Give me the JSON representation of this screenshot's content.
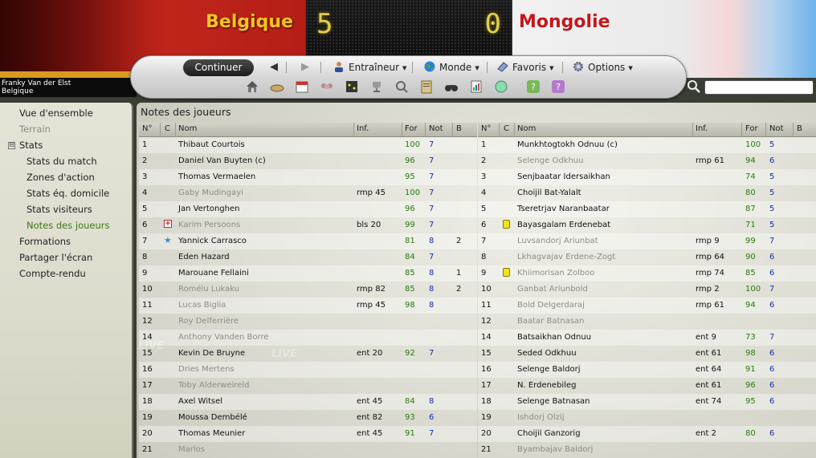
{
  "header": {
    "home_team": "Belgique",
    "away_team": "Mongolie",
    "home_score": "5",
    "away_score": "0",
    "manager_name": "Franky Van der Elst",
    "manager_team": "Belgique"
  },
  "toolbar": {
    "continue_label": "Continuer",
    "back_icon": "back-arrow-icon",
    "forward_icon": "forward-arrow-icon",
    "menus": [
      {
        "label": "Entraîneur",
        "icon": "person-icon"
      },
      {
        "label": "Monde",
        "icon": "globe-icon"
      },
      {
        "label": "Favoris",
        "icon": "bookmark-icon"
      },
      {
        "label": "Options",
        "icon": "gear-icon"
      }
    ],
    "icons": [
      "home-icon",
      "inbox-icon",
      "calendar-icon",
      "squad-icon",
      "tactics-icon",
      "trophy-icon",
      "scout-icon",
      "clipboard-icon",
      "binoculars-icon",
      "report-icon",
      "world-icon",
      "help-icon",
      "question-icon"
    ]
  },
  "search": {
    "placeholder": "",
    "value": ""
  },
  "sidebar": {
    "items": [
      {
        "label": "Vue d'ensemble",
        "state": "normal"
      },
      {
        "label": "Terrain",
        "state": "disabled"
      },
      {
        "label": "Stats",
        "state": "normal"
      },
      {
        "label": "Stats du match",
        "state": "normal"
      },
      {
        "label": "Zones d'action",
        "state": "normal"
      },
      {
        "label": "Stats éq. domicile",
        "state": "normal"
      },
      {
        "label": "Stats visiteurs",
        "state": "normal"
      },
      {
        "label": "Notes des joueurs",
        "state": "active"
      },
      {
        "label": "Formations",
        "state": "normal"
      },
      {
        "label": "Partager l'écran",
        "state": "normal"
      },
      {
        "label": "Compte-rendu",
        "state": "normal"
      }
    ],
    "stats_toggle": "⊟"
  },
  "main": {
    "title": "Notes des joueurs",
    "columns": [
      "N°",
      "C",
      "Nom",
      "Inf.",
      "For",
      "Not",
      "B"
    ],
    "watermark": "LIVE"
  },
  "home_players": [
    {
      "num": "1",
      "mark": "",
      "name": "Thibaut Courtois",
      "inf": "",
      "for": "100",
      "not": "7",
      "b": "",
      "unused": false
    },
    {
      "num": "2",
      "mark": "",
      "name": "Daniel Van Buyten (c)",
      "inf": "",
      "for": "96",
      "not": "7",
      "b": "",
      "unused": false
    },
    {
      "num": "3",
      "mark": "",
      "name": "Thomas Vermaelen",
      "inf": "",
      "for": "95",
      "not": "7",
      "b": "",
      "unused": false
    },
    {
      "num": "4",
      "mark": "",
      "name": "Gaby Mudingayi",
      "inf": "rmp 45",
      "for": "100",
      "not": "7",
      "b": "",
      "unused": true
    },
    {
      "num": "5",
      "mark": "",
      "name": "Jan Vertonghen",
      "inf": "",
      "for": "96",
      "not": "7",
      "b": "",
      "unused": false
    },
    {
      "num": "6",
      "mark": "injury",
      "name": "Karim Persoons",
      "inf": "bls 20",
      "for": "99",
      "not": "7",
      "b": "",
      "unused": true
    },
    {
      "num": "7",
      "mark": "star",
      "name": "Yannick Carrasco",
      "inf": "",
      "for": "81",
      "not": "8",
      "b": "2",
      "unused": false
    },
    {
      "num": "8",
      "mark": "",
      "name": "Eden Hazard",
      "inf": "",
      "for": "84",
      "not": "7",
      "b": "",
      "unused": false
    },
    {
      "num": "9",
      "mark": "",
      "name": "Marouane Fellaini",
      "inf": "",
      "for": "85",
      "not": "8",
      "b": "1",
      "unused": false
    },
    {
      "num": "10",
      "mark": "",
      "name": "Romélu Lukaku",
      "inf": "rmp 82",
      "for": "85",
      "not": "8",
      "b": "2",
      "unused": true
    },
    {
      "num": "11",
      "mark": "",
      "name": "Lucas Biglia",
      "inf": "rmp 45",
      "for": "98",
      "not": "8",
      "b": "",
      "unused": true
    },
    {
      "num": "12",
      "mark": "",
      "name": "Roy Delferrière",
      "inf": "",
      "for": "",
      "not": "",
      "b": "",
      "unused": true
    },
    {
      "num": "14",
      "mark": "",
      "name": "Anthony Vanden Borre",
      "inf": "",
      "for": "",
      "not": "",
      "b": "",
      "unused": true
    },
    {
      "num": "15",
      "mark": "",
      "name": "Kevin De Bruyne",
      "inf": "ent 20",
      "for": "92",
      "not": "7",
      "b": "",
      "unused": false
    },
    {
      "num": "16",
      "mark": "",
      "name": "Dries Mertens",
      "inf": "",
      "for": "",
      "not": "",
      "b": "",
      "unused": true
    },
    {
      "num": "17",
      "mark": "",
      "name": "Toby Alderweireld",
      "inf": "",
      "for": "",
      "not": "",
      "b": "",
      "unused": true
    },
    {
      "num": "18",
      "mark": "",
      "name": "Axel Witsel",
      "inf": "ent 45",
      "for": "84",
      "not": "8",
      "b": "",
      "unused": false
    },
    {
      "num": "19",
      "mark": "",
      "name": "Moussa Dembélé",
      "inf": "ent 82",
      "for": "93",
      "not": "6",
      "b": "",
      "unused": false
    },
    {
      "num": "20",
      "mark": "",
      "name": "Thomas Meunier",
      "inf": "ent 45",
      "for": "91",
      "not": "7",
      "b": "",
      "unused": false
    },
    {
      "num": "21",
      "mark": "",
      "name": "Marlos",
      "inf": "",
      "for": "",
      "not": "",
      "b": "",
      "unused": true
    }
  ],
  "away_players": [
    {
      "num": "1",
      "mark": "",
      "name": "Munkhtogtokh Odnuu (c)",
      "inf": "",
      "for": "100",
      "not": "5",
      "b": "",
      "unused": false
    },
    {
      "num": "2",
      "mark": "",
      "name": "Selenge Odkhuu",
      "inf": "rmp 61",
      "for": "94",
      "not": "6",
      "b": "",
      "unused": true
    },
    {
      "num": "3",
      "mark": "",
      "name": "Senjbaatar Idersaikhan",
      "inf": "",
      "for": "74",
      "not": "5",
      "b": "",
      "unused": false
    },
    {
      "num": "4",
      "mark": "",
      "name": "Choijil Bat-Yalalt",
      "inf": "",
      "for": "80",
      "not": "5",
      "b": "",
      "unused": false
    },
    {
      "num": "5",
      "mark": "",
      "name": "Tseretrjav Naranbaatar",
      "inf": "",
      "for": "87",
      "not": "5",
      "b": "",
      "unused": false
    },
    {
      "num": "6",
      "mark": "yellow",
      "name": "Bayasgalam Erdenebat",
      "inf": "",
      "for": "71",
      "not": "5",
      "b": "",
      "unused": false
    },
    {
      "num": "7",
      "mark": "",
      "name": "Luvsandorj Ariunbat",
      "inf": "rmp 9",
      "for": "99",
      "not": "7",
      "b": "",
      "unused": true
    },
    {
      "num": "8",
      "mark": "",
      "name": "Lkhagvajav Erdene-Zogt",
      "inf": "rmp 64",
      "for": "90",
      "not": "6",
      "b": "",
      "unused": true
    },
    {
      "num": "9",
      "mark": "yellow",
      "name": "Khiimorisan Zolboo",
      "inf": "rmp 74",
      "for": "85",
      "not": "6",
      "b": "",
      "unused": true
    },
    {
      "num": "10",
      "mark": "",
      "name": "Ganbat Ariunbold",
      "inf": "rmp 2",
      "for": "100",
      "not": "7",
      "b": "",
      "unused": true
    },
    {
      "num": "11",
      "mark": "",
      "name": "Bold Delgerdaraj",
      "inf": "rmp 61",
      "for": "94",
      "not": "6",
      "b": "",
      "unused": true
    },
    {
      "num": "12",
      "mark": "",
      "name": "Baatar Batnasan",
      "inf": "",
      "for": "",
      "not": "",
      "b": "",
      "unused": true
    },
    {
      "num": "14",
      "mark": "",
      "name": "Batsaikhan Odnuu",
      "inf": "ent 9",
      "for": "73",
      "not": "7",
      "b": "",
      "unused": false
    },
    {
      "num": "15",
      "mark": "",
      "name": "Seded Odkhuu",
      "inf": "ent 61",
      "for": "98",
      "not": "6",
      "b": "",
      "unused": false
    },
    {
      "num": "16",
      "mark": "",
      "name": "Selenge Baldorj",
      "inf": "ent 64",
      "for": "91",
      "not": "6",
      "b": "",
      "unused": false
    },
    {
      "num": "17",
      "mark": "",
      "name": "N. Erdenebileg",
      "inf": "ent 61",
      "for": "96",
      "not": "6",
      "b": "",
      "unused": false
    },
    {
      "num": "18",
      "mark": "",
      "name": "Selenge Batnasan",
      "inf": "ent 74",
      "for": "95",
      "not": "6",
      "b": "",
      "unused": false
    },
    {
      "num": "19",
      "mark": "",
      "name": "Ishdorj Olzij",
      "inf": "",
      "for": "",
      "not": "",
      "b": "",
      "unused": true
    },
    {
      "num": "20",
      "mark": "",
      "name": "Choijil Ganzorig",
      "inf": "ent 2",
      "for": "80",
      "not": "6",
      "b": "",
      "unused": false
    },
    {
      "num": "21",
      "mark": "",
      "name": "Byambajav Baldorj",
      "inf": "",
      "for": "",
      "not": "",
      "b": "",
      "unused": true
    }
  ],
  "colors": {
    "home_primary": "#c0251b",
    "home_name": "#f5c51e",
    "away_name": "#c4161c",
    "score": "#e2cf4a",
    "active_nav": "#3d7a14",
    "fitness": "#2a7a0c",
    "rating": "#1d2ea8"
  }
}
